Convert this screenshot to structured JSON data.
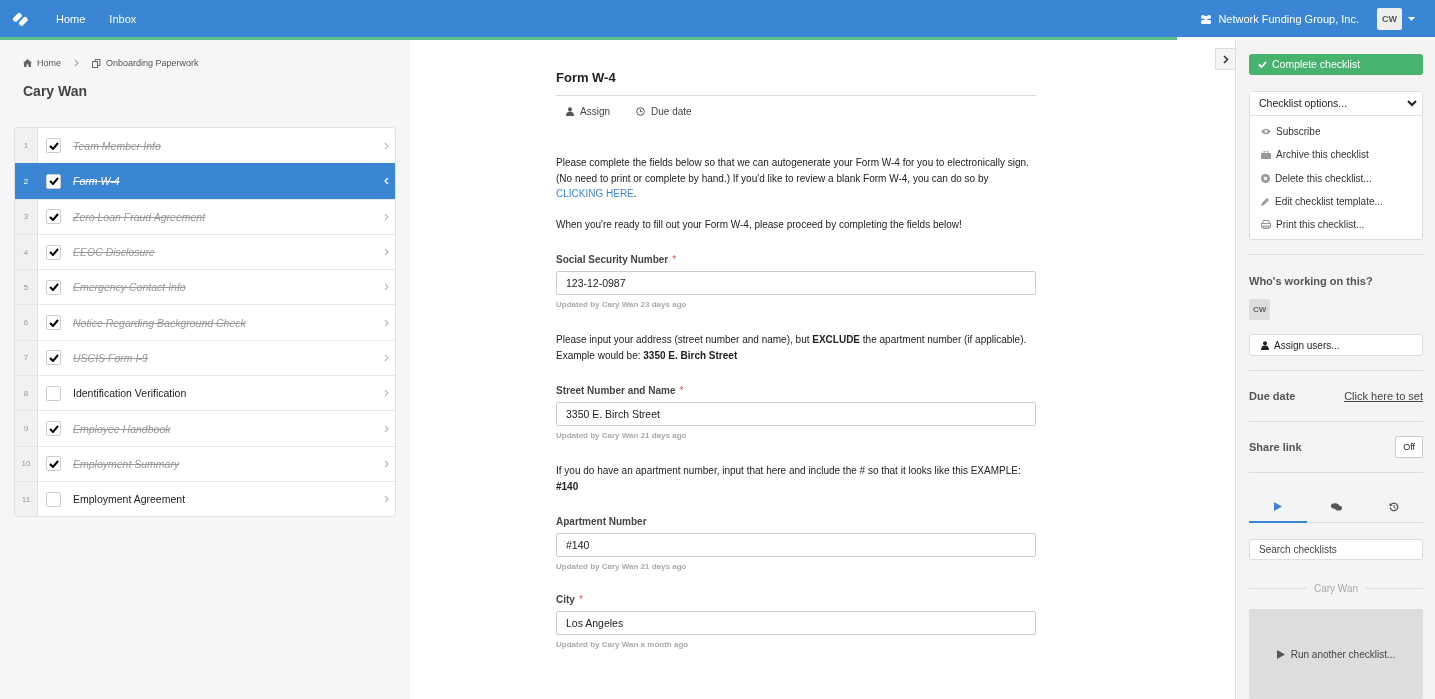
{
  "nav": {
    "links": [
      "Home",
      "Inbox"
    ],
    "org": "Network Funding Group, Inc.",
    "avatar": "CW"
  },
  "progress": {
    "level": 0.82
  },
  "breadcrumb": [
    "Home",
    "Onboarding Paperwork"
  ],
  "checklist_title": "Cary Wan",
  "tasks": [
    {
      "number": "1",
      "label": "Team Member Info",
      "checked": true,
      "selected": false
    },
    {
      "number": "2",
      "label": "Form W-4",
      "checked": true,
      "selected": true
    },
    {
      "number": "3",
      "label": "Zero Loan Fraud Agreement",
      "checked": true,
      "selected": false
    },
    {
      "number": "4",
      "label": "EEOC Disclosure",
      "checked": true,
      "selected": false
    },
    {
      "number": "5",
      "label": "Emergency Contact Info",
      "checked": true,
      "selected": false
    },
    {
      "number": "6",
      "label": "Notice Regarding Background Check",
      "checked": true,
      "selected": false
    },
    {
      "number": "7",
      "label": "USCIS Form I-9",
      "checked": true,
      "selected": false
    },
    {
      "number": "8",
      "label": "Identification Verification",
      "checked": false,
      "selected": false
    },
    {
      "number": "9",
      "label": "Employee Handbook",
      "checked": true,
      "selected": false
    },
    {
      "number": "10",
      "label": "Employment Summary",
      "checked": true,
      "selected": false
    },
    {
      "number": "11",
      "label": "Employment Agreement",
      "checked": false,
      "selected": false
    }
  ],
  "form": {
    "title": "Form W-4",
    "actions": [
      {
        "kind": "assign",
        "label": "Assign"
      },
      {
        "kind": "due",
        "label": "Due date"
      }
    ],
    "blocks": [
      {
        "kind": "paragraph",
        "text": "Please complete the fields below so that we can autogenerate your Form W-4 for you to electronically sign. (No need to print or complete by hand.) If you'd like to review a blank Form W-4, you can do so by ",
        "link": "CLICKING HERE",
        "after": "."
      },
      {
        "kind": "paragraph",
        "text": "When you're ready to fill out your Form W-4, please proceed by completing the fields below!"
      },
      {
        "kind": "field",
        "label": "Social Security Number",
        "required_mark": "*",
        "value": "123-12-0987",
        "note": "Updated by Cary Wan 23 days ago"
      },
      {
        "kind": "paragraph",
        "text": "Please input your address (street number and name), but **EXCLUDE** the apartment number (if applicable). Example would be: **3350 E. Birch Street**"
      },
      {
        "kind": "field",
        "label": "Street Number and Name",
        "required_mark": "*",
        "value": "3350 E. Birch Street",
        "note": "Updated by Cary Wan 21 days ago"
      },
      {
        "kind": "paragraph",
        "text": "If you do have an apartment number, input that here and include the # so that it looks like this EXAMPLE: **#140**"
      },
      {
        "kind": "field",
        "label": "Apartment Number",
        "value": "#140",
        "note": "Updated by Cary Wan 21 days ago"
      },
      {
        "kind": "field",
        "label": "City",
        "required_mark": "*",
        "value": "Los Angeles",
        "note": "Updated by Cary Wan a month ago"
      }
    ]
  },
  "sidebar": {
    "complete_button": "Complete checklist",
    "options": {
      "label": "Checklist options...",
      "items": [
        {
          "kind": "eye",
          "label": "Subscribe"
        },
        {
          "kind": "briefcase",
          "label": "Archive this checklist"
        },
        {
          "kind": "delete",
          "label": "Delete this checklist..."
        },
        {
          "kind": "pencil",
          "label": "Edit checklist template..."
        },
        {
          "kind": "print",
          "label": "Print this checklist..."
        }
      ]
    },
    "who_title": "Who's working on this?",
    "assignees": [
      "CW"
    ],
    "assign_button": "Assign users...",
    "due_date": {
      "label": "Due date",
      "link": "Click here to set"
    },
    "share_link": {
      "label": "Share link",
      "toggle": "Off"
    },
    "tabs": [
      {
        "kind": "play",
        "selected": true
      },
      {
        "kind": "comments",
        "selected": false
      },
      {
        "kind": "history",
        "selected": false
      }
    ],
    "search": {
      "placeholder": "Search checklists"
    },
    "section_label": "Cary Wan",
    "run_button": "Run another checklist..."
  }
}
